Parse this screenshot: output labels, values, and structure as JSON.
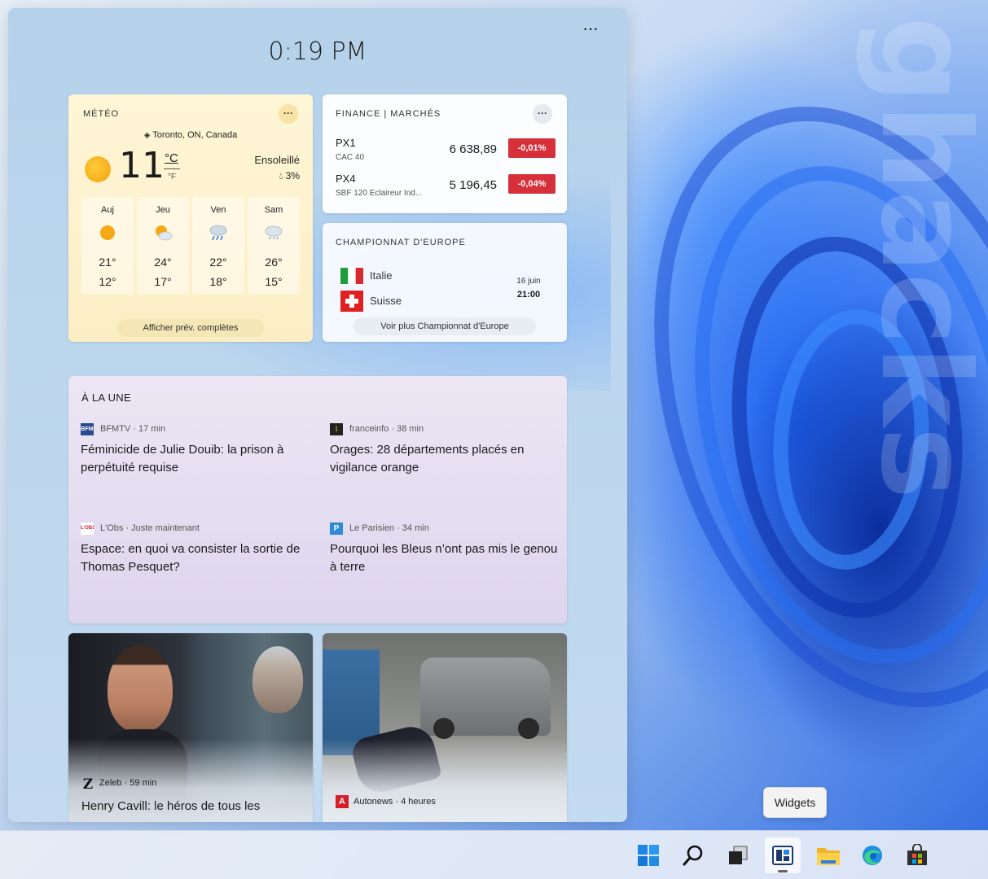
{
  "panel": {
    "time": "0:19 PM",
    "more": "···"
  },
  "weather": {
    "title": "MÉTÉO",
    "more": "···",
    "location": "Toronto, ON, Canada",
    "temp": "11",
    "unit_c": "°C",
    "unit_f": "°F",
    "condition": "Ensoleillé",
    "precip": "3%",
    "forecast": [
      {
        "day": "Auj",
        "hi": "21°",
        "lo": "12°",
        "icon": "sun-icon"
      },
      {
        "day": "Jeu",
        "hi": "24°",
        "lo": "17°",
        "icon": "partly-cloudy-icon"
      },
      {
        "day": "Ven",
        "hi": "22°",
        "lo": "18°",
        "icon": "rain-icon"
      },
      {
        "day": "Sam",
        "hi": "26°",
        "lo": "15°",
        "icon": "rain-icon"
      }
    ],
    "full_forecast": "Afficher prév. complètes"
  },
  "finance": {
    "title": "FINANCE | MARCHÉS",
    "more": "···",
    "stocks": [
      {
        "name": "PX1",
        "sub": "CAC 40",
        "value": "6 638,89",
        "change": "-0,01%"
      },
      {
        "name": "PX4",
        "sub": "SBF 120 Eclaireur Ind...",
        "value": "5 196,45",
        "change": "-0,04%"
      }
    ],
    "colors": {
      "down": "#d6303a"
    }
  },
  "euro": {
    "title": "CHAMPIONNAT D'EUROPE",
    "team1": "Italie",
    "team2": "Suisse",
    "date": "16 juin",
    "time": "21:00",
    "more_link": "Voir plus Championnat d'Europe"
  },
  "news": {
    "title": "À LA UNE",
    "stories": [
      {
        "source": "BFMTV · 17 min",
        "logo": "BFM TV",
        "headline": "Féminicide de Julie Douib: la prison à perpétuité requise"
      },
      {
        "source": "franceinfo · 38 min",
        "logo": "",
        "headline": "Orages: 28 départements placés en vigilance orange"
      },
      {
        "source": "L'Obs · Juste maintenant",
        "logo": "L'OBS",
        "headline": "Espace: en quoi va consister la sortie de Thomas Pesquet?"
      },
      {
        "source": "Le Parisien · 34 min",
        "logo": "P",
        "headline": "Pourquoi les Bleus n’ont pas mis le genou à terre"
      }
    ]
  },
  "image_cards": [
    {
      "source": "Zeleb · 59 min",
      "logo": "Z",
      "title": "Henry Cavill: le héros de tous les"
    },
    {
      "source": "Autonews · 4 heures",
      "logo": "A",
      "title": ""
    }
  ],
  "tooltip": "Widgets",
  "taskbar": {
    "icons": [
      "start-icon",
      "search-icon",
      "task-view-icon",
      "widgets-icon",
      "file-explorer-icon",
      "edge-icon",
      "store-icon"
    ]
  }
}
